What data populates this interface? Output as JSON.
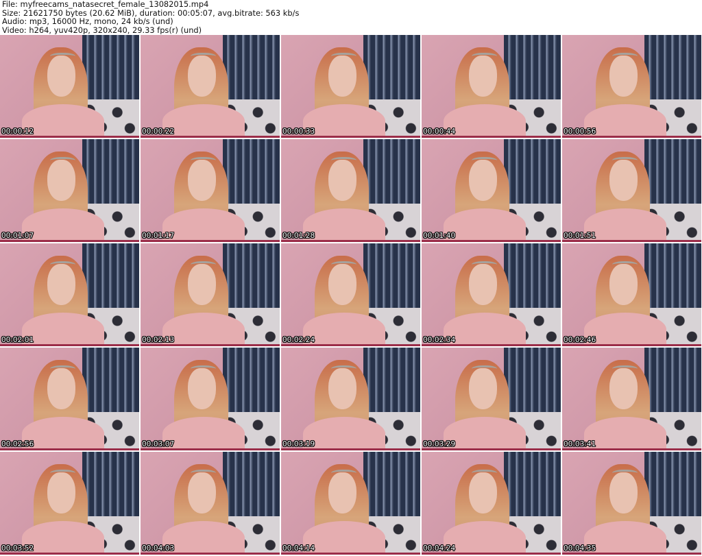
{
  "header": {
    "file": "File: myfreecams_natasecret_female_13082015.mp4",
    "size": "Size: 21621750 bytes (20.62 MiB), duration: 00:05:07, avg.bitrate: 563 kb/s",
    "audio": "Audio: mp3, 16000 Hz, mono, 24 kb/s (und)",
    "video": "Video: h264, yuv420p, 320x240, 29.33 fps(r) (und)"
  },
  "thumbnails": [
    {
      "timestamp": "00:00:12"
    },
    {
      "timestamp": "00:00:22"
    },
    {
      "timestamp": "00:00:33"
    },
    {
      "timestamp": "00:00:44"
    },
    {
      "timestamp": "00:00:56"
    },
    {
      "timestamp": "00:01:07"
    },
    {
      "timestamp": "00:01:17"
    },
    {
      "timestamp": "00:01:28"
    },
    {
      "timestamp": "00:01:40"
    },
    {
      "timestamp": "00:01:51"
    },
    {
      "timestamp": "00:02:01"
    },
    {
      "timestamp": "00:02:13"
    },
    {
      "timestamp": "00:02:24"
    },
    {
      "timestamp": "00:02:34"
    },
    {
      "timestamp": "00:02:46"
    },
    {
      "timestamp": "00:02:56"
    },
    {
      "timestamp": "00:03:07"
    },
    {
      "timestamp": "00:03:19"
    },
    {
      "timestamp": "00:03:29"
    },
    {
      "timestamp": "00:03:41"
    },
    {
      "timestamp": "00:03:52"
    },
    {
      "timestamp": "00:04:03"
    },
    {
      "timestamp": "00:04:14"
    },
    {
      "timestamp": "00:04:24"
    },
    {
      "timestamp": "00:04:35"
    }
  ]
}
